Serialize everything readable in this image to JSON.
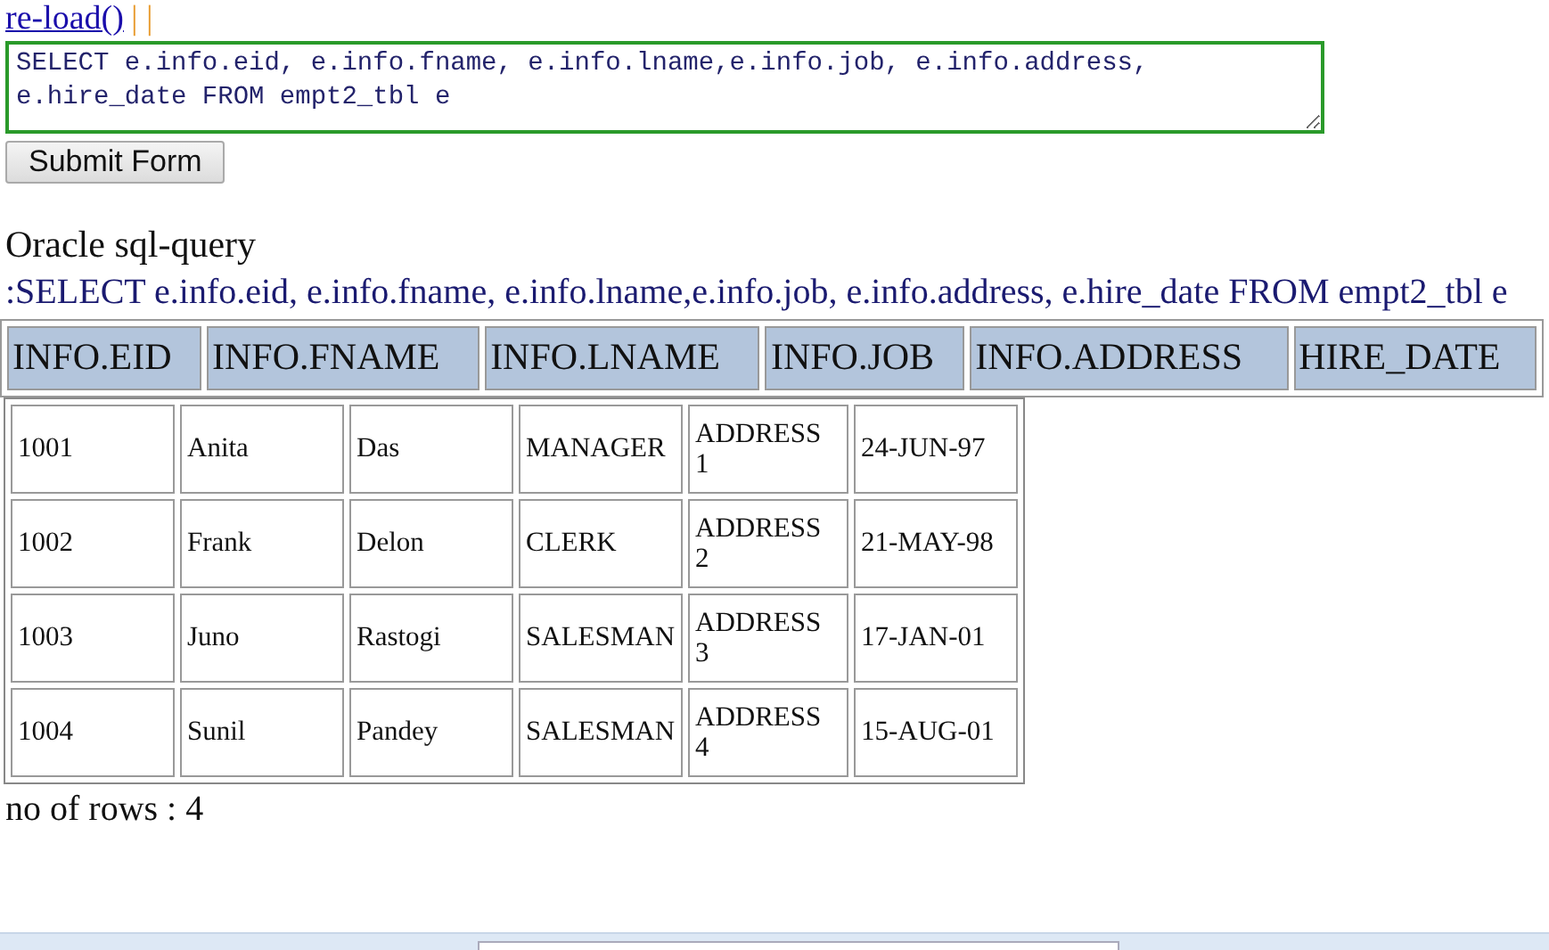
{
  "reload_link": "re-load()",
  "separator": "| |",
  "query_box": {
    "value": "SELECT e.info.eid, e.info.fname, e.info.lname,e.info.job, e.info.address, e.hire_date FROM empt2_tbl e"
  },
  "submit_button": "Submit Form",
  "result_title": "Oracle sql-query",
  "query_text": ":SELECT e.info.eid, e.info.fname, e.info.lname,e.info.job, e.info.address, e.hire_date FROM empt2_tbl e",
  "header_columns": [
    "INFO.EID",
    "INFO.FNAME",
    "INFO.LNAME",
    "INFO.JOB",
    "INFO.ADDRESS",
    "HIRE_DATE"
  ],
  "rows": [
    [
      "1001",
      "Anita",
      "Das",
      "MANAGER",
      "ADDRESS 1",
      "24-JUN-97"
    ],
    [
      "1002",
      "Frank",
      "Delon",
      "CLERK",
      "ADDRESS 2",
      "21-MAY-98"
    ],
    [
      "1003",
      "Juno",
      "Rastogi",
      "SALESMAN",
      "ADDRESS 3",
      "17-JAN-01"
    ],
    [
      "1004",
      "Sunil",
      "Pandey",
      "SALESMAN",
      "ADDRESS 4",
      "15-AUG-01"
    ]
  ],
  "row_count": "no of rows : 4"
}
